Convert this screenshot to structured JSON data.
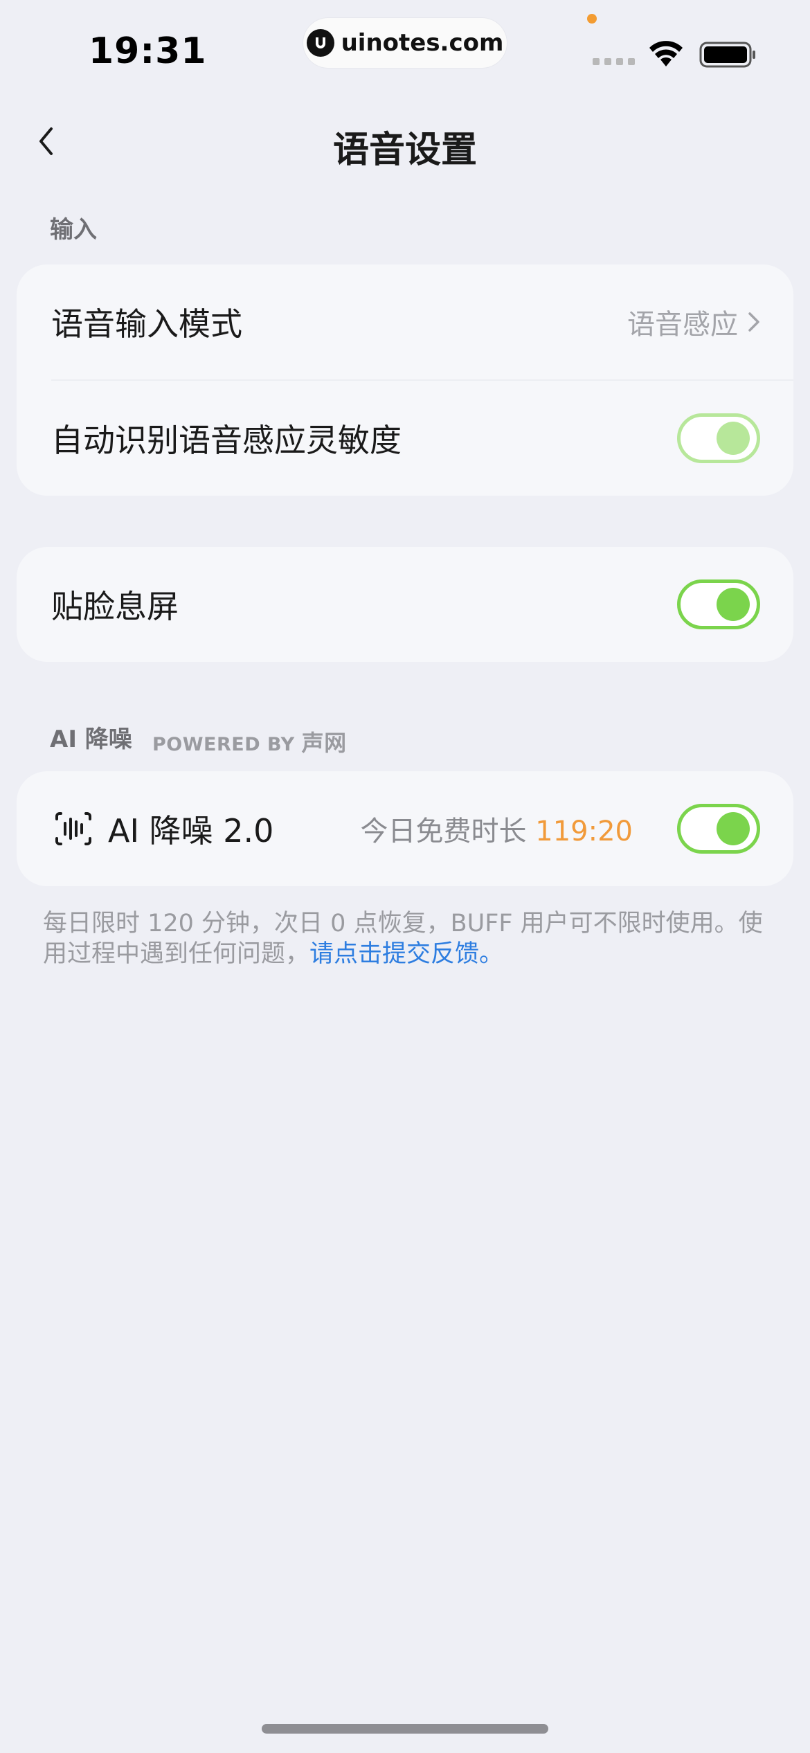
{
  "status_bar": {
    "time": "19:31",
    "url": "uinotes.com"
  },
  "nav": {
    "title": "语音设置"
  },
  "sections": {
    "input_label": "输入",
    "ai_label": "AI 降噪",
    "powered_by_prefix": "POWERED BY",
    "powered_by_brand": "声网"
  },
  "input_card": {
    "voice_input_mode_label": "语音输入模式",
    "voice_input_mode_value": "语音感应",
    "auto_sensitivity_label": "自动识别语音感应灵敏度",
    "auto_sensitivity_on": true
  },
  "proximity_card": {
    "label": "贴脸息屏",
    "on": true
  },
  "ai_card": {
    "label": "AI 降噪 2.0",
    "free_prefix": "今日免费时长",
    "free_time": "119:20",
    "on": true
  },
  "footnote": {
    "text": "每日限时 120 分钟，次日 0 点恢复，BUFF 用户可不限时使用。使用过程中遇到任何问题，",
    "link": "请点击提交反馈。"
  },
  "colors": {
    "accent_green": "#7bd44c",
    "accent_green_light": "#b7e79a",
    "timer_orange": "#f19a3a",
    "link_blue": "#2d7de0",
    "background": "#eeeff5"
  }
}
